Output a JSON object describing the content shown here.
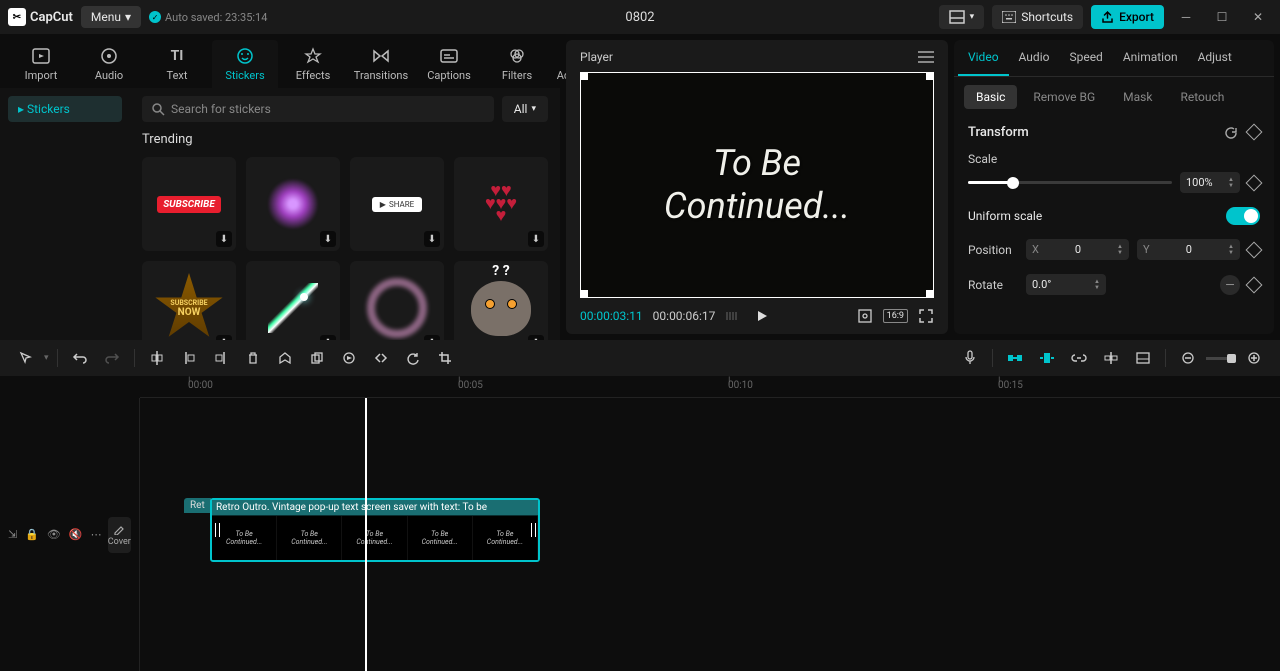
{
  "app": {
    "name": "CapCut",
    "menu": "Menu",
    "autosave": "Auto saved: 23:35:14",
    "project": "0802"
  },
  "titlebar": {
    "shortcuts": "Shortcuts",
    "export": "Export"
  },
  "topTabs": [
    "Import",
    "Audio",
    "Text",
    "Stickers",
    "Effects",
    "Transitions",
    "Captions",
    "Filters",
    "Adjustment"
  ],
  "topTabsActive": 3,
  "sidebar": {
    "item": "Stickers"
  },
  "search": {
    "placeholder": "Search for stickers",
    "all": "All"
  },
  "section": {
    "trending": "Trending"
  },
  "stickers": {
    "subscribe": "SUBSCRIBE",
    "share": "SHARE",
    "subnow1": "SUBSCRIBE",
    "subnow2": "NOW"
  },
  "player": {
    "title": "Player",
    "text1": "To Be",
    "text2": "Continued...",
    "time_cur": "00:00:03:11",
    "time_dur": "00:00:06:17",
    "aspect": "16:9"
  },
  "rightTabs": [
    "Video",
    "Audio",
    "Speed",
    "Animation",
    "Adjust"
  ],
  "rightSub": [
    "Basic",
    "Remove BG",
    "Mask",
    "Retouch"
  ],
  "props": {
    "transform": "Transform",
    "scale": "Scale",
    "scale_val": "100%",
    "uniform": "Uniform scale",
    "position": "Position",
    "x": "X",
    "xval": "0",
    "y": "Y",
    "yval": "0",
    "rotate": "Rotate",
    "rotate_val": "0.0°"
  },
  "ruler": {
    "t0": "00:00",
    "t5": "00:05",
    "t10": "00:10",
    "t15": "00:15"
  },
  "cover": "Cover",
  "clip": {
    "behind": "Ret",
    "label": "Retro Outro. Vintage pop-up text screen saver with text: To be",
    "thumb1": "To Be",
    "thumb2": "Continued..."
  }
}
